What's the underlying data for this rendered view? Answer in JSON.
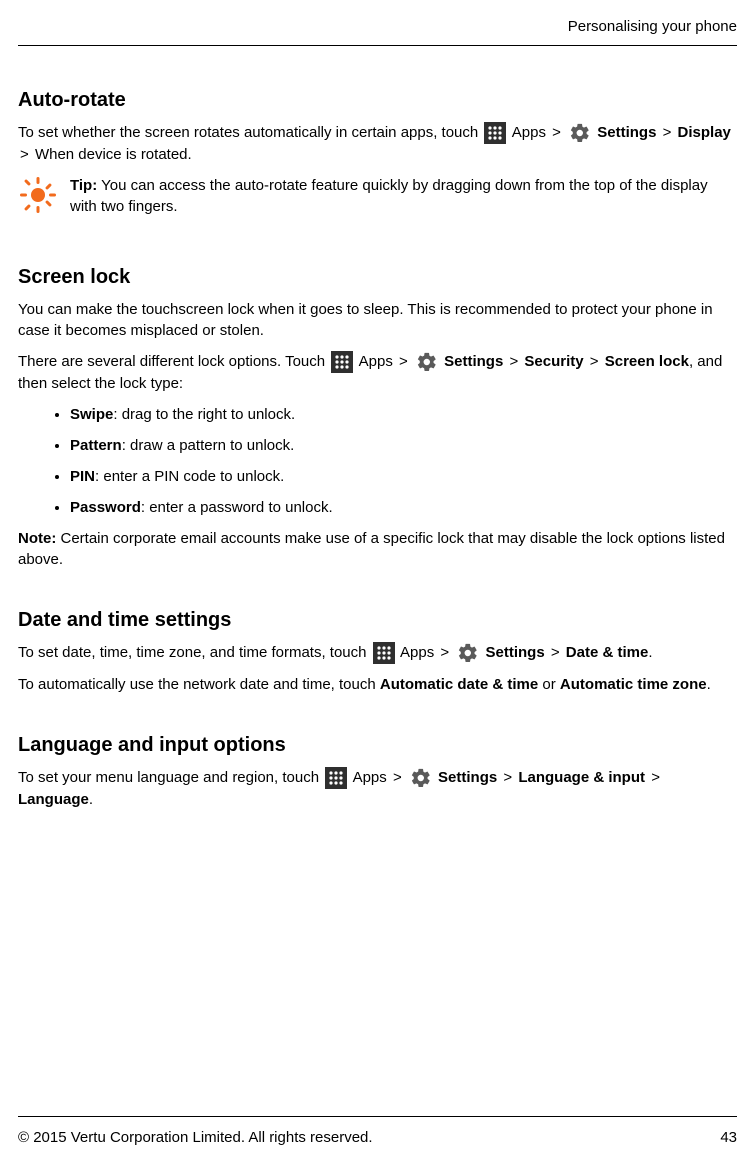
{
  "header": {
    "title": "Personalising your phone"
  },
  "sections": {
    "autoRotate": {
      "heading": "Auto-rotate",
      "p1_a": "To set whether the screen rotates automatically in certain apps, touch ",
      "apps": "Apps",
      "sep": ">",
      "settings": "Settings",
      "display": "Display",
      "p1_b": " When device is rotated.",
      "tipLabel": "Tip:",
      "tipText": " You can access the auto-rotate feature quickly by dragging down from the top of the display with two fingers."
    },
    "screenLock": {
      "heading": "Screen lock",
      "p1": "You can make the touchscreen lock when it goes to sleep. This is recommended to protect your phone in case it becomes misplaced or stolen.",
      "p2_a": "There are several different lock options. Touch ",
      "apps": "Apps",
      "sep": ">",
      "settings": "Settings",
      "security": "Security",
      "screenLock": "Screen lock",
      "p2_b": ", and then select the lock type:",
      "items": [
        {
          "name": "Swipe",
          "desc": ": drag to the right to unlock."
        },
        {
          "name": "Pattern",
          "desc": ": draw a pattern to unlock."
        },
        {
          "name": "PIN",
          "desc": ": enter a PIN code to unlock."
        },
        {
          "name": "Password",
          "desc": ": enter a password to unlock."
        }
      ],
      "noteLabel": "Note:",
      "noteText": " Certain corporate email accounts make use of a specific lock that may disable the lock options listed above."
    },
    "dateTime": {
      "heading": "Date and time settings",
      "p1_a": "To set date, time, time zone, and time formats, touch ",
      "apps": "Apps",
      "sep": ">",
      "settings": "Settings",
      "dateTime": "Date & time",
      "period": ".",
      "p2_a": "To automatically use the network date and time, touch ",
      "autoDateTime": "Automatic date & time",
      "or": " or ",
      "autoTz": "Automatic time zone",
      "period2": "."
    },
    "language": {
      "heading": "Language and input options",
      "p1_a": "To set your menu language and region, touch ",
      "apps": "Apps",
      "sep": ">",
      "settings": "Settings",
      "langInput": "Language & input",
      "language": "Language",
      "period": "."
    }
  },
  "footer": {
    "copyright": "© 2015 Vertu Corporation Limited. All rights reserved.",
    "pageNum": "43"
  }
}
